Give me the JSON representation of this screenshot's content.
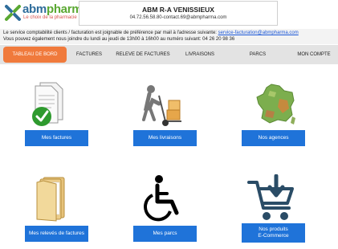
{
  "brand": {
    "name_part1": "abm",
    "name_part2": "pharma",
    "tagline": "Le choix de la pharmacie",
    "colors": {
      "blue": "#2f6d9b",
      "green": "#5aa832",
      "tagline_red": "#d9534f"
    }
  },
  "agency": {
    "name": "ABM R-A VENISSIEUX",
    "contact": "04.72.56.58.80-contact.69@abmpharma.com"
  },
  "info": {
    "line1_text": "Le service comptabilité clients / facturation est joignable de préférence par mail à l'adresse suivante: ",
    "line1_email": "service-facturation@abmpharma.com",
    "line2_text": "Vous pouvez également nous joindre du lundi au jeudi de 13h00 à 16h00 au numéro suivant: 04 26 20 98 36"
  },
  "nav": {
    "active_label": "TABLEAU DE BORD",
    "items": [
      "FACTURES",
      "RELEVE DE FACTURES",
      "LIVRAISONS",
      "PARCS",
      "MON COMPTE"
    ]
  },
  "tiles": [
    {
      "label": "Mes factures",
      "icon": "invoice-check-icon"
    },
    {
      "label": "Mes livraisons",
      "icon": "delivery-hand-truck-icon"
    },
    {
      "label": "Nos agences",
      "icon": "france-map-icon"
    },
    {
      "label": "Mes relevés de factures",
      "icon": "folders-icon"
    },
    {
      "label": "Mes parcs",
      "icon": "wheelchair-icon"
    },
    {
      "label_line1": "Nos produits",
      "label_line2": "E-Commerce",
      "icon": "shopping-cart-download-icon"
    }
  ],
  "colors": {
    "accent_orange": "#f07a3c",
    "button_blue": "#1f73d9",
    "main_background": "#ffffff",
    "nav_background": "#e3e3e3"
  }
}
